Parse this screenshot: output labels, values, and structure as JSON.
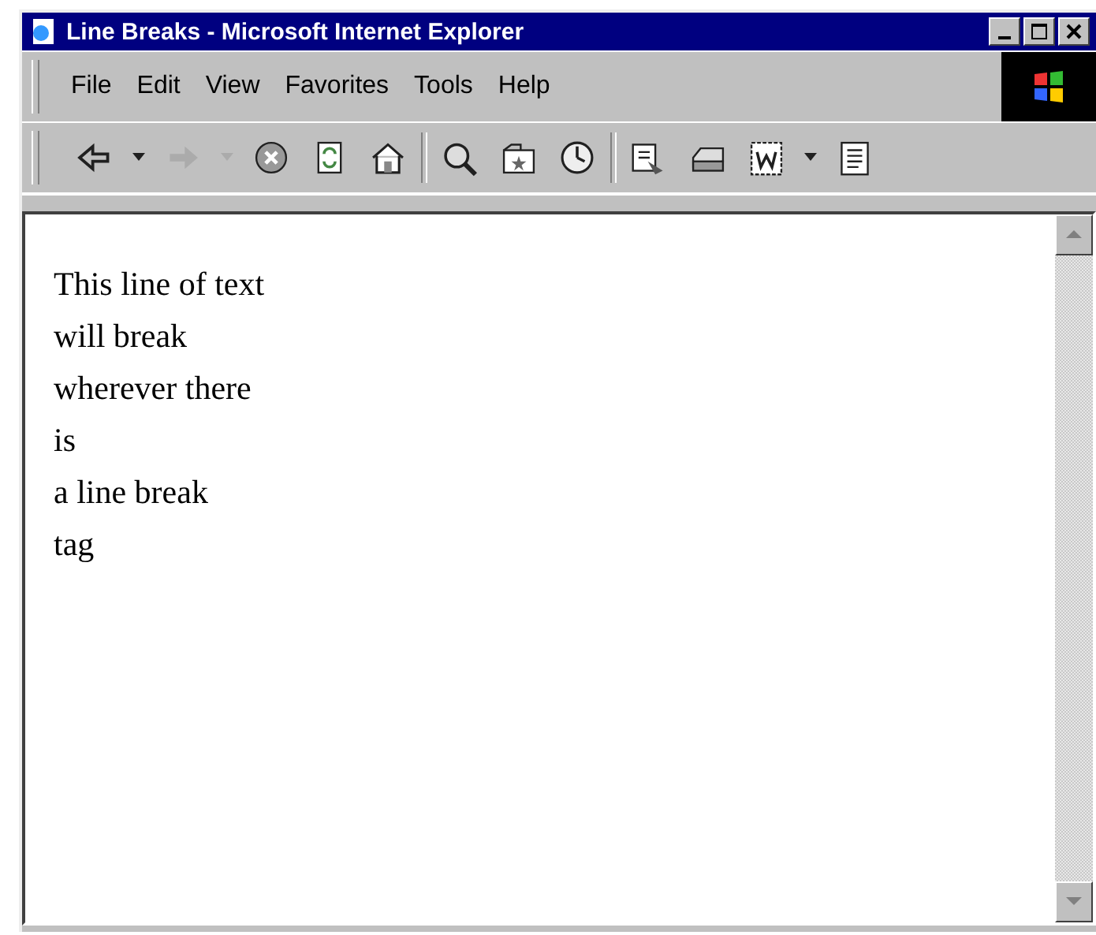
{
  "window": {
    "title": "Line Breaks - Microsoft Internet Explorer"
  },
  "menu": [
    {
      "label": "File"
    },
    {
      "label": "Edit"
    },
    {
      "label": "View"
    },
    {
      "label": "Favorites"
    },
    {
      "label": "Tools"
    },
    {
      "label": "Help"
    }
  ],
  "toolbar": [
    {
      "kind": "back",
      "disabled": false
    },
    {
      "kind": "caret",
      "disabled": false
    },
    {
      "kind": "forward",
      "disabled": true
    },
    {
      "kind": "caret",
      "disabled": true
    },
    {
      "kind": "stop",
      "disabled": false
    },
    {
      "kind": "refresh",
      "disabled": false
    },
    {
      "kind": "home",
      "disabled": false
    },
    {
      "kind": "separator"
    },
    {
      "kind": "search",
      "disabled": false
    },
    {
      "kind": "favorites",
      "disabled": false
    },
    {
      "kind": "history",
      "disabled": false
    },
    {
      "kind": "separator"
    },
    {
      "kind": "mail",
      "disabled": false
    },
    {
      "kind": "print",
      "disabled": false
    },
    {
      "kind": "edit",
      "disabled": false
    },
    {
      "kind": "caret",
      "disabled": false
    },
    {
      "kind": "discuss",
      "disabled": false
    }
  ],
  "page": {
    "lines": [
      "This line of text",
      "will break",
      "wherever there",
      "is",
      "a line break",
      "tag"
    ]
  }
}
